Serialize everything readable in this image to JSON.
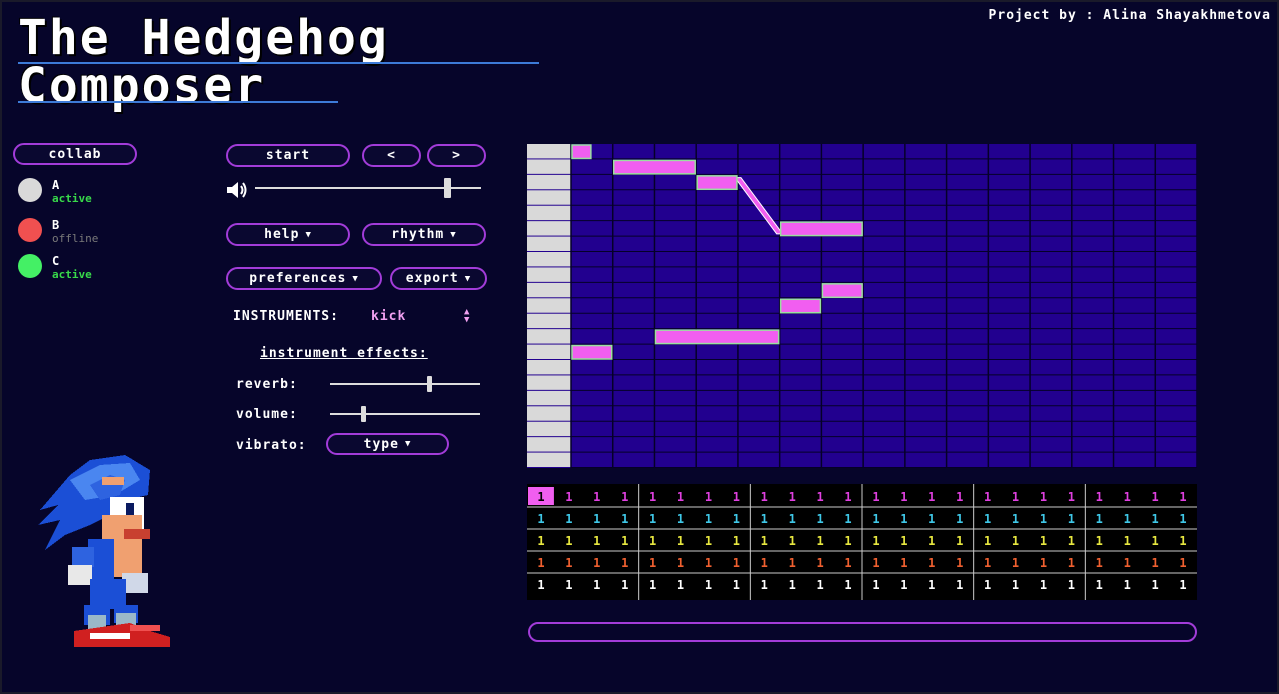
{
  "app": {
    "title_line1": "The Hedgehog",
    "title_line2": "Composer",
    "credit": "Project by : Alina Shayakhmetova"
  },
  "collab": {
    "button_label": "collab",
    "users": [
      {
        "name": "A",
        "status": "active",
        "color": "#d9d9d9",
        "status_color": "#38d94a"
      },
      {
        "name": "B",
        "status": "offline",
        "color": "#f05050",
        "status_color": "#7a7a7a"
      },
      {
        "name": "C",
        "status": "active",
        "color": "#44f065",
        "status_color": "#38d94a"
      }
    ]
  },
  "controls": {
    "start_label": "start",
    "prev_label": "<",
    "next_label": ">",
    "master_volume": 0.85,
    "help_label": "help",
    "rhythm_label": "rhythm",
    "preferences_label": "preferences",
    "export_label": "export",
    "instruments_label": "INSTRUMENTS:",
    "instrument_value": "kick",
    "effects_title": "instrument effects:",
    "reverb_label": "reverb:",
    "reverb_value": 0.66,
    "volume_label": "volume:",
    "volume_value": 0.22,
    "vibrato_label": "vibrato:",
    "vibrato_type_label": "type"
  },
  "piano_roll": {
    "rows": 21,
    "cols": 15,
    "colors": {
      "background": "#22008f",
      "note": "#f15ef0",
      "key": "#d9d9d9"
    },
    "notes": [
      {
        "row": 0,
        "start": 0,
        "len": 0.5
      },
      {
        "row": 1,
        "start": 1,
        "len": 2
      },
      {
        "row": 2,
        "start": 3,
        "len": 1
      },
      {
        "row": 5,
        "start": 5,
        "len": 2
      },
      {
        "row": 9,
        "start": 6,
        "len": 1
      },
      {
        "row": 10,
        "start": 5,
        "len": 1
      },
      {
        "row": 12,
        "start": 2,
        "len": 3
      },
      {
        "row": 13,
        "start": 0,
        "len": 1
      }
    ],
    "slides": [
      {
        "from_row": 2,
        "from_col": 4,
        "to_row": 5,
        "to_col": 5
      }
    ]
  },
  "beat_grid": {
    "columns": 24,
    "value": "1",
    "current_step": 1,
    "row_colors": [
      "#e040e0",
      "#3fc8e8",
      "#e8e840",
      "#f06030",
      "#ffffff"
    ]
  },
  "colors": {
    "background": "#06052a",
    "accent": "#a23cd9",
    "underline": "#3d7bd8"
  }
}
